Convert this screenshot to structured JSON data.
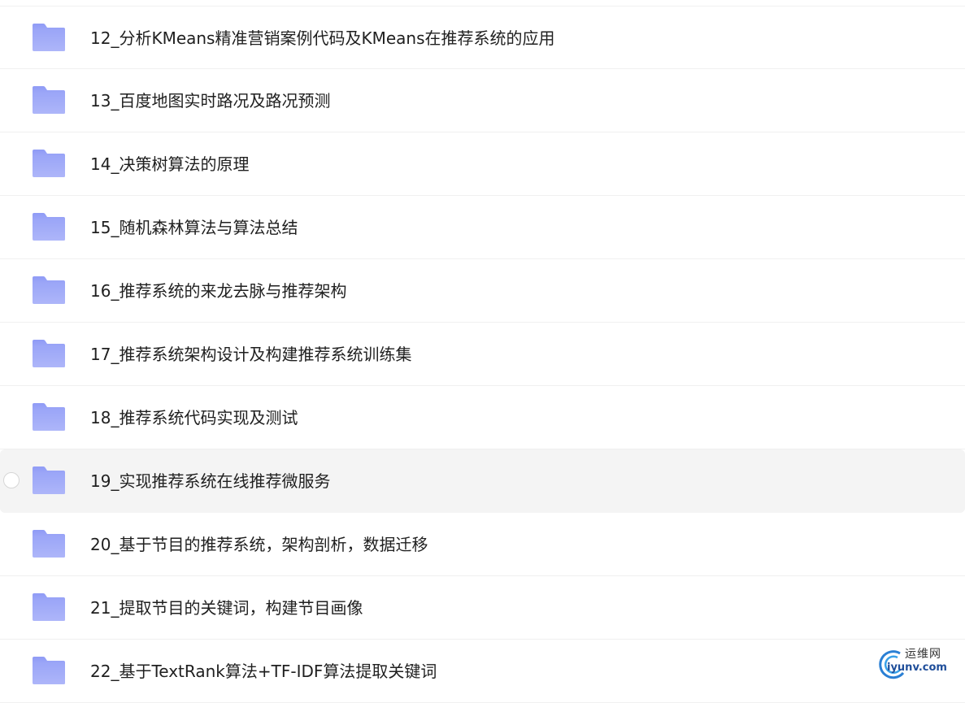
{
  "folders": [
    {
      "name": "12_分析KMeans精准营销案例代码及KMeans在推荐系统的应用"
    },
    {
      "name": "13_百度地图实时路况及路况预测"
    },
    {
      "name": "14_决策树算法的原理"
    },
    {
      "name": "15_随机森林算法与算法总结"
    },
    {
      "name": "16_推荐系统的来龙去脉与推荐架构"
    },
    {
      "name": "17_推荐系统架构设计及构建推荐系统训练集"
    },
    {
      "name": "18_推荐系统代码实现及测试"
    },
    {
      "name": "19_实现推荐系统在线推荐微服务"
    },
    {
      "name": "20_基于节目的推荐系统，架构剖析，数据迁移"
    },
    {
      "name": "21_提取节目的关键词，构建节目画像"
    },
    {
      "name": "22_基于TextRank算法+TF-IDF算法提取关键词"
    }
  ],
  "hover_index": 7,
  "folder_icon": "folder-icon",
  "colors": {
    "folder_top": "#8f9bf6",
    "folder_bottom": "#c4c9fb",
    "hover_bg": "#f4f4f4",
    "text": "#1f1f1f"
  },
  "watermark": {
    "cn": "运维网",
    "en": "iyunv.com"
  }
}
